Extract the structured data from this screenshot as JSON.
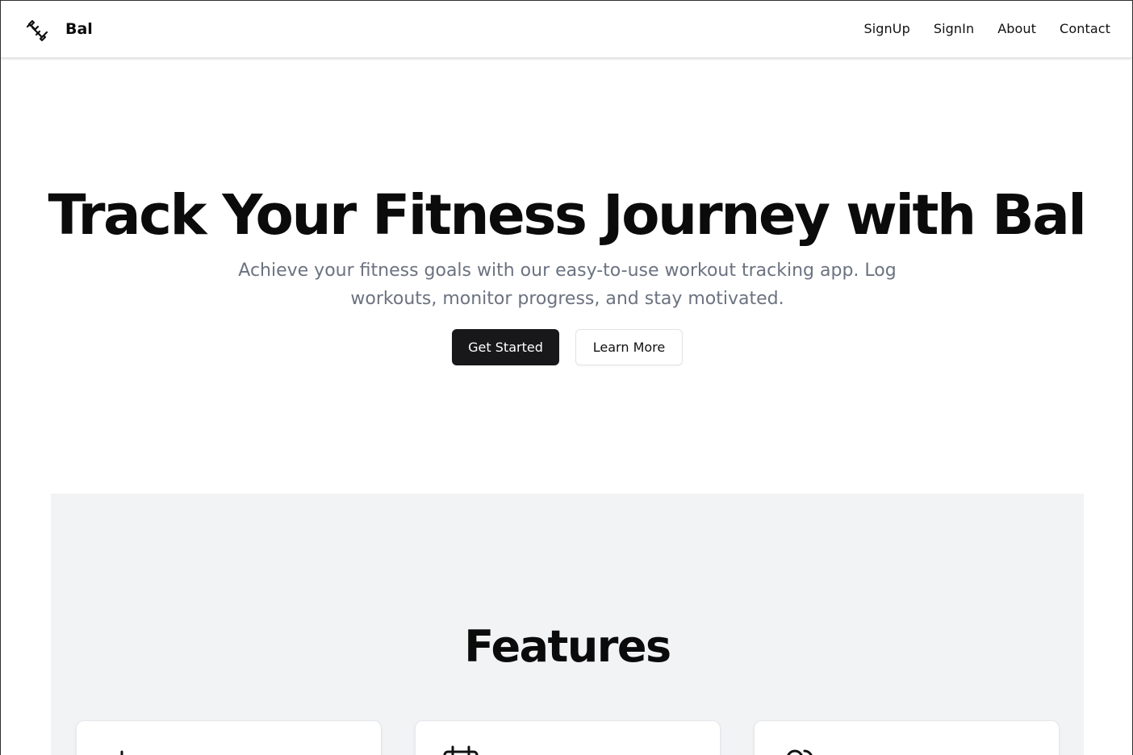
{
  "header": {
    "brand": "Bal",
    "logo_icon": "dumbbell-icon",
    "nav": [
      {
        "label": "SignUp"
      },
      {
        "label": "SignIn"
      },
      {
        "label": "About"
      },
      {
        "label": "Contact"
      }
    ]
  },
  "hero": {
    "title": "Track Your Fitness Journey with Bal",
    "subtitle": "Achieve your fitness goals with our easy-to-use workout tracking app. Log workouts, monitor progress, and stay motivated.",
    "primary_button": "Get Started",
    "secondary_button": "Learn More"
  },
  "features": {
    "title": "Features",
    "cards": [
      {
        "icon": "plus-icon"
      },
      {
        "icon": "calendar-icon"
      },
      {
        "icon": "users-icon"
      }
    ]
  },
  "colors": {
    "primary_button_bg": "#18181b",
    "features_bg": "#f2f3f5",
    "subtitle_text": "#6b7280"
  }
}
